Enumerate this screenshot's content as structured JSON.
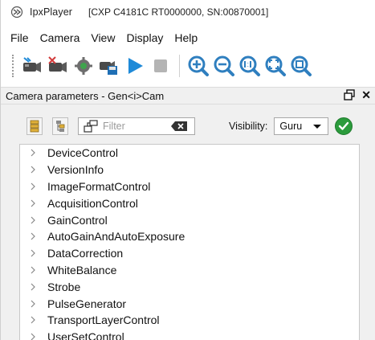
{
  "window": {
    "title": "IpxPlayer",
    "camera_info": "[CXP C4181C RT0000000, SN:00870001]"
  },
  "menu": [
    "File",
    "Camera",
    "View",
    "Display",
    "Help"
  ],
  "toolbar": {
    "icons": [
      "camera-connect-icon",
      "camera-disconnect-icon",
      "camera-settings-icon",
      "camera-save-icon",
      "play-icon",
      "stop-icon",
      "zoom-in-icon",
      "zoom-out-icon",
      "zoom-actual-icon",
      "zoom-fit-icon",
      "zoom-select-icon"
    ]
  },
  "panel": {
    "title": "Camera parameters - Gen<i>Cam"
  },
  "filter": {
    "placeholder": "Filter",
    "visibility_label": "Visibility:",
    "visibility_value": "Guru"
  },
  "tree_items": [
    "DeviceControl",
    "VersionInfo",
    "ImageFormatControl",
    "AcquisitionControl",
    "GainControl",
    "AutoGainAndAutoExposure",
    "DataCorrection",
    "WhiteBalance",
    "Strobe",
    "PulseGenerator",
    "TransportLayerControl",
    "UserSetControl"
  ],
  "colors": {
    "accent_blue": "#1f8ad8",
    "ok_green": "#2b9b3c"
  }
}
